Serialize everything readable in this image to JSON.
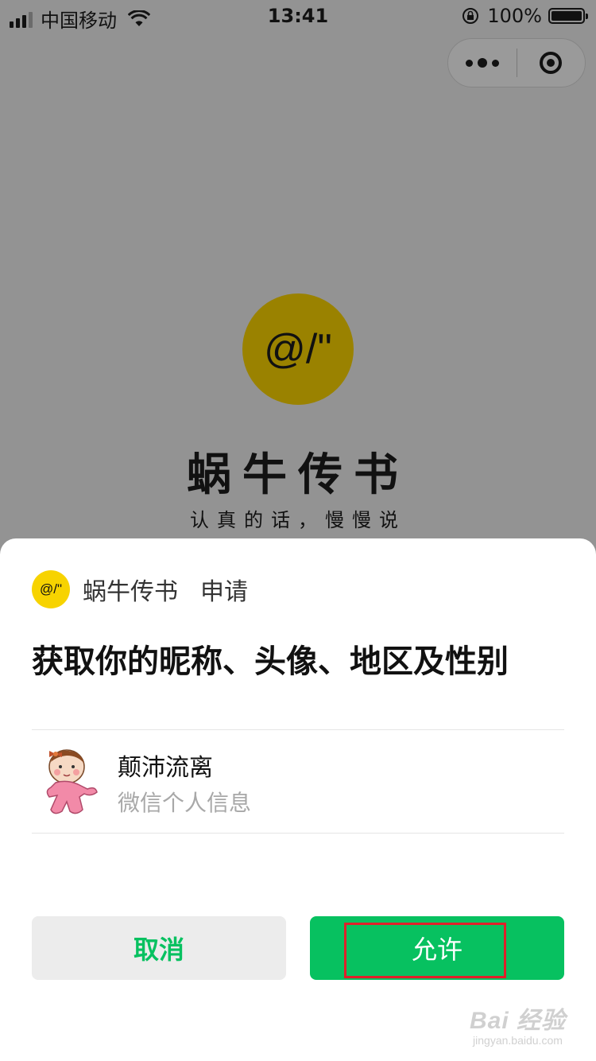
{
  "status_bar": {
    "carrier": "中国移动",
    "time": "13:41",
    "battery": "100%"
  },
  "capsule": {
    "more_icon": "more-dots-icon",
    "close_icon": "close-circle-icon"
  },
  "hero": {
    "logo_text": "@/\"",
    "title": "蜗牛传书",
    "subtitle": "认真的话，慢慢说"
  },
  "sheet": {
    "logo_text": "@/\"",
    "app_name": "蜗牛传书",
    "request_label": "申请",
    "permission_title": "获取你的昵称、头像、地区及性别",
    "user": {
      "nickname": "颠沛流离",
      "info_label": "微信个人信息"
    },
    "buttons": {
      "cancel": "取消",
      "allow": "允许"
    }
  },
  "watermark": {
    "main": "Bai 经验",
    "sub": "jingyan.baidu.com"
  },
  "colors": {
    "accent_green": "#07c160",
    "logo_yellow": "#f7d300",
    "highlight_red": "#e0202a"
  }
}
